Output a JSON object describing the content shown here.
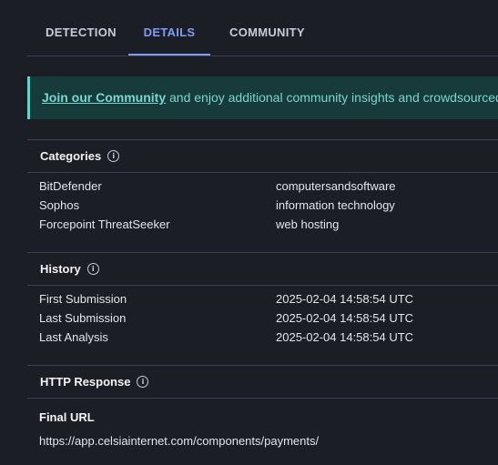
{
  "tabs": [
    {
      "label": "DETECTION"
    },
    {
      "label": "DETAILS"
    },
    {
      "label": "COMMUNITY"
    }
  ],
  "banner": {
    "link_text": "Join our Community",
    "text": " and enjoy additional community insights and crowdsourced det"
  },
  "categories": {
    "title": "Categories",
    "rows": [
      {
        "key": "BitDefender",
        "value": "computersandsoftware"
      },
      {
        "key": "Sophos",
        "value": "information technology"
      },
      {
        "key": "Forcepoint ThreatSeeker",
        "value": "web hosting"
      }
    ]
  },
  "history": {
    "title": "History",
    "rows": [
      {
        "key": "First Submission",
        "value": "2025-02-04 14:58:54 UTC"
      },
      {
        "key": "Last Submission",
        "value": "2025-02-04 14:58:54 UTC"
      },
      {
        "key": "Last Analysis",
        "value": "2025-02-04 14:58:54 UTC"
      }
    ]
  },
  "http_response": {
    "title": "HTTP Response",
    "final_url_label": "Final URL",
    "final_url": "https://app.celsiainternet.com/components/payments/"
  },
  "icons": {
    "info": "info-circle-icon"
  },
  "colors": {
    "accent": "#7f9cf5",
    "banner_bg": "#173a3a",
    "banner_text": "#79d6cf",
    "background": "#1b1e25"
  }
}
